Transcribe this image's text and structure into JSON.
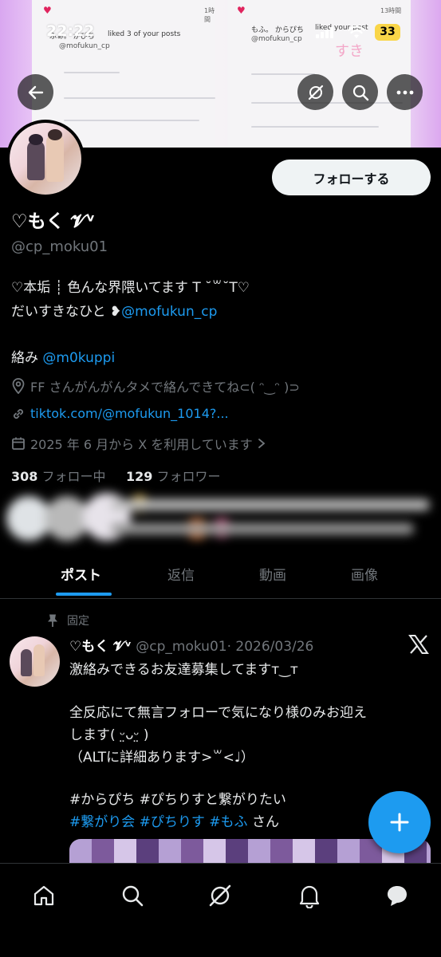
{
  "status_bar": {
    "time": "22:22",
    "battery": "33"
  },
  "banner": {
    "left_card": {
      "time": "1時間",
      "text": "ふぁ。 かぴち",
      "liked": "liked 3 of your posts",
      "sub": "@mofukun_cp"
    },
    "right_card": {
      "time": "13時間",
      "text": "もふ。 からぴち",
      "liked": "liked your post",
      "sub": "@mofukun_cp",
      "sticker": "すき"
    }
  },
  "profile": {
    "follow_label": "フォローする",
    "name": "♡もく 𝓥ᵛ",
    "handle": "@cp_moku01",
    "bio_line1": "♡本垢 ┊ 色んな界隈いてます T ˘꒳˘T♡",
    "bio_line2_text": "だいすきなひと ❥",
    "bio_line2_link": "@mofukun_cp",
    "bio_line3_text": "絡み ",
    "bio_line3_link": "@m0kuppi",
    "location": "FF さんがんがんタメで絡んできてね⊂( ᵔ‿ᵔ )⊃",
    "website": "tiktok.com/@mofukun_1014?...",
    "joined": "2025 年 6 月から X を利用しています",
    "following_count": "308",
    "following_label": "フォロー中",
    "followers_count": "129",
    "followers_label": "フォロワー"
  },
  "tabs": [
    {
      "label": "ポスト"
    },
    {
      "label": "返信"
    },
    {
      "label": "動画"
    },
    {
      "label": "画像"
    }
  ],
  "post": {
    "pinned_label": "固定",
    "author_name": "♡もく 𝓥ᵛ",
    "author_handle": "@cp_moku01",
    "date": "· 2026/03/26",
    "lines": [
      "激絡みできるお友達募集してますт‿т",
      "",
      "全反応にて無言フォローで気になり様のみお迎え",
      "します( ᵕ̤ᴗᵕ̤ )",
      "（ALTに詳細あります>꒳<♩）",
      "",
      "#からぴち #ぴちりすと繋がりたい",
      " #繋がり会 #ぴちりす #もふ さん"
    ]
  },
  "colors": {
    "accent": "#1d9bf0",
    "background": "#000000",
    "muted": "#71767b"
  }
}
